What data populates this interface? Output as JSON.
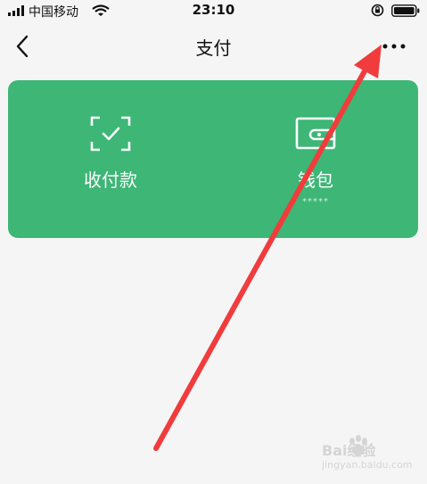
{
  "status_bar": {
    "carrier": "中国移动",
    "time": "23:10",
    "icons": [
      "signal-icon",
      "wifi-icon",
      "rotation-lock-icon",
      "battery-icon"
    ]
  },
  "nav": {
    "title": "支付",
    "back_icon": "chevron-left-icon",
    "more_icon": "more-dots-icon"
  },
  "card": {
    "color": "#3db676",
    "items": [
      {
        "label": "收付款",
        "icon": "scan-check-icon",
        "sub": ""
      },
      {
        "label": "钱包",
        "icon": "wallet-icon",
        "sub": "*****"
      }
    ]
  },
  "annotation": {
    "color": "#f03c3c",
    "icon": "red-arrow-annotation"
  },
  "watermark": {
    "text": "Bai经验",
    "sub": "jingyan.baidu.com"
  }
}
